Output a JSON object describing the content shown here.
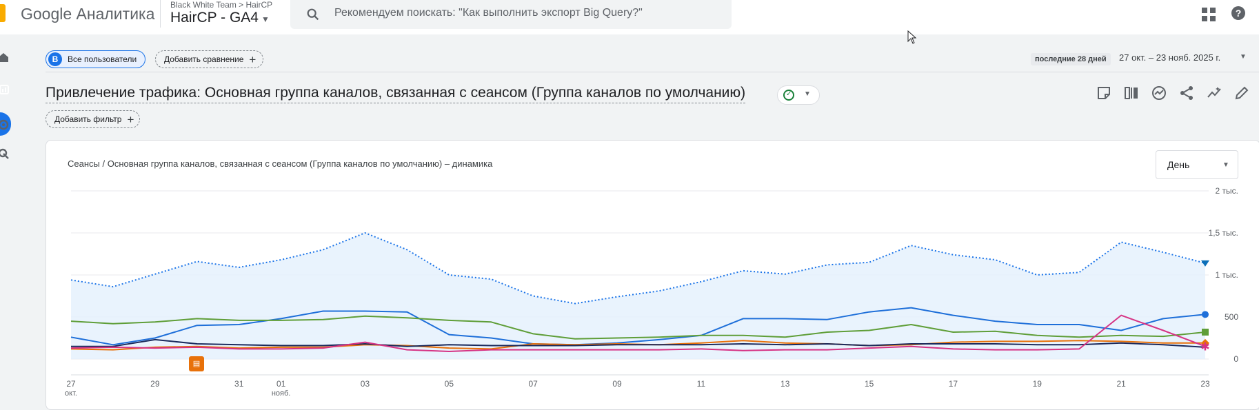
{
  "header": {
    "product": "Google Аналитика",
    "breadcrumb_account": "Black White Team",
    "breadcrumb_sep": ">",
    "breadcrumb_property": "HairCP",
    "property": "HairCP - GA4",
    "search_placeholder": "Рекомендуем поискать: \"Как выполнить экспорт Big Query?\""
  },
  "segment": {
    "avatar": "B",
    "label": "Все пользователи"
  },
  "add_comparison": "Добавить сравнение",
  "date": {
    "preset": "последние 28 дней",
    "range": "27 окт. – 23 нояб. 2025 г."
  },
  "report": {
    "title": "Привлечение трафика: Основная группа каналов, связанная с сеансом (Группа каналов по умолчанию)",
    "add_filter": "Добавить фильтр"
  },
  "icons": [
    "home-icon",
    "reports-icon",
    "explore-icon",
    "advertising-icon",
    "search-icon",
    "apps-icon",
    "help-icon",
    "status-check-icon",
    "notes-icon",
    "compare-icon",
    "insights-icon",
    "share-icon",
    "anomaly-icon",
    "edit-icon",
    "chevron-down-icon",
    "annotation-icon"
  ],
  "colors": {
    "accent": "#1a73e8",
    "total": "#1a73e8",
    "blue": "#1e6fd9",
    "green": "#5f9e38",
    "orange": "#e8710a",
    "navy": "#1b2a5c",
    "pink": "#d63384"
  },
  "chart_data": {
    "type": "line",
    "title": "Сеансы / Основная группа каналов, связанная с сеансом (Группа каналов по умолчанию) – динамика",
    "granularity": "День",
    "x": [
      "27 окт.",
      "28",
      "29",
      "30",
      "31",
      "01 нояб.",
      "02",
      "03",
      "04",
      "05",
      "06",
      "07",
      "08",
      "09",
      "10",
      "11",
      "12",
      "13",
      "14",
      "15",
      "16",
      "17",
      "18",
      "19",
      "20",
      "21",
      "22",
      "23"
    ],
    "x_tick_labels": [
      {
        "label": "27",
        "sub": "окт."
      },
      {
        "label": "29",
        "sub": ""
      },
      {
        "label": "31",
        "sub": ""
      },
      {
        "label": "01",
        "sub": "нояб."
      },
      {
        "label": "03",
        "sub": ""
      },
      {
        "label": "05",
        "sub": ""
      },
      {
        "label": "07",
        "sub": ""
      },
      {
        "label": "09",
        "sub": ""
      },
      {
        "label": "11",
        "sub": ""
      },
      {
        "label": "13",
        "sub": ""
      },
      {
        "label": "15",
        "sub": ""
      },
      {
        "label": "17",
        "sub": ""
      },
      {
        "label": "19",
        "sub": ""
      },
      {
        "label": "21",
        "sub": ""
      },
      {
        "label": "23",
        "sub": ""
      }
    ],
    "x_tick_index": [
      0,
      2,
      4,
      5,
      7,
      9,
      11,
      13,
      15,
      17,
      19,
      21,
      23,
      25,
      27
    ],
    "y_ticks": [
      {
        "value": 0,
        "label": "0"
      },
      {
        "value": 500,
        "label": "500"
      },
      {
        "value": 1000,
        "label": "1 тыс."
      },
      {
        "value": 1500,
        "label": "1,5 тыс."
      },
      {
        "value": 2000,
        "label": "2 тыс."
      }
    ],
    "ylim": [
      0,
      2000
    ],
    "grid": true,
    "series": [
      {
        "color": "#1a73e8",
        "style": "dotted",
        "area": true,
        "marker": "pin",
        "values": [
          940,
          860,
          1010,
          1160,
          1090,
          1180,
          1300,
          1500,
          1300,
          1000,
          950,
          750,
          660,
          740,
          810,
          920,
          1050,
          1010,
          1120,
          1150,
          1350,
          1240,
          1180,
          1000,
          1030,
          1390,
          1270,
          1140
        ]
      },
      {
        "color": "#1e6fd9",
        "style": "solid",
        "marker": "circle",
        "values": [
          260,
          170,
          250,
          400,
          410,
          480,
          570,
          570,
          560,
          290,
          250,
          180,
          170,
          190,
          230,
          280,
          480,
          480,
          470,
          560,
          610,
          520,
          450,
          410,
          410,
          340,
          480,
          530
        ]
      },
      {
        "color": "#5f9e38",
        "style": "solid",
        "marker": "square",
        "values": [
          450,
          420,
          440,
          480,
          460,
          460,
          470,
          510,
          490,
          460,
          440,
          300,
          240,
          250,
          260,
          280,
          280,
          260,
          320,
          340,
          410,
          320,
          330,
          280,
          260,
          280,
          270,
          320
        ]
      },
      {
        "color": "#e8710a",
        "style": "solid",
        "marker": "diamond",
        "values": [
          120,
          110,
          140,
          150,
          130,
          140,
          140,
          170,
          160,
          130,
          120,
          180,
          170,
          180,
          170,
          190,
          220,
          190,
          180,
          160,
          170,
          200,
          210,
          210,
          220,
          210,
          190,
          190
        ]
      },
      {
        "color": "#1b2a5c",
        "style": "solid",
        "marker": "none",
        "values": [
          150,
          150,
          230,
          180,
          170,
          160,
          160,
          180,
          150,
          170,
          160,
          160,
          160,
          170,
          170,
          170,
          180,
          170,
          180,
          160,
          180,
          180,
          180,
          170,
          170,
          190,
          170,
          140
        ]
      },
      {
        "color": "#d63384",
        "style": "solid",
        "marker": "star",
        "values": [
          130,
          140,
          130,
          140,
          120,
          120,
          130,
          200,
          110,
          90,
          110,
          110,
          110,
          110,
          110,
          120,
          100,
          110,
          110,
          130,
          150,
          120,
          110,
          110,
          120,
          520,
          340,
          150
        ]
      }
    ]
  }
}
